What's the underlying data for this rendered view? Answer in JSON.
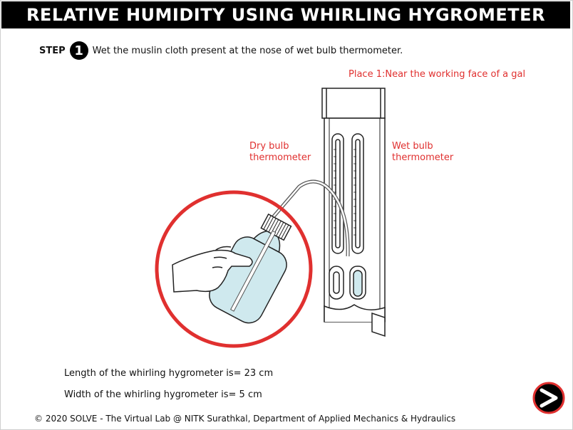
{
  "header": {
    "title": "RELATIVE HUMIDITY USING WHIRLING HYGROMETER"
  },
  "step": {
    "label": "STEP",
    "number": "1",
    "instruction": "Wet the muslin cloth present at the nose of wet bulb thermometer."
  },
  "place": {
    "text": "Place 1:Near the working face of a gal"
  },
  "labels": {
    "dry_bulb_line1": "Dry bulb",
    "dry_bulb_line2": "thermometer",
    "wet_bulb_line1": "Wet bulb",
    "wet_bulb_line2": "thermometer"
  },
  "dimensions": {
    "length": "Length of the whirling hygrometer is= 23 cm",
    "width": "Width of the whirling hygrometer is= 5 cm"
  },
  "footer": {
    "text": "© 2020 SOLVE - The Virtual Lab @ NITK Surathkal, Department of Applied Mechanics & Hydraulics"
  },
  "icons": {
    "next": "next-arrow-icon",
    "bottle": "wash-bottle-icon",
    "hand": "hand-icon"
  },
  "colors": {
    "accent_red": "#e0302f",
    "title_bg": "#000000",
    "bottle_fill": "#cfe9ee"
  }
}
